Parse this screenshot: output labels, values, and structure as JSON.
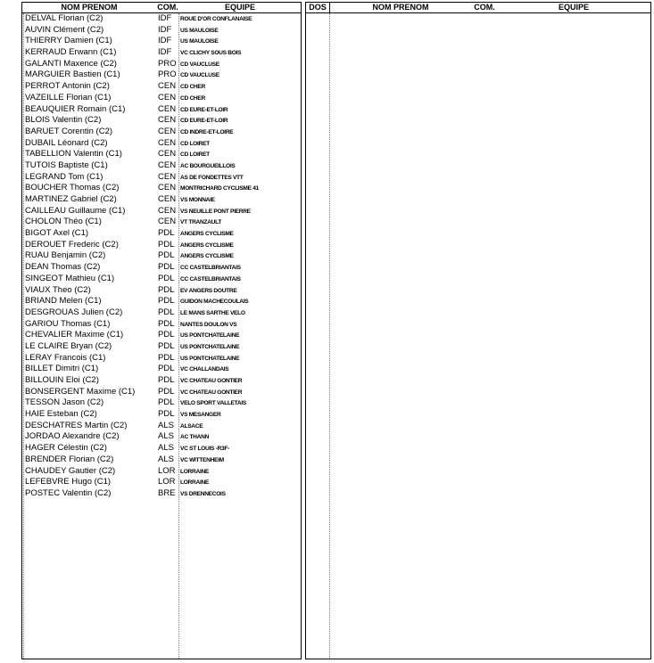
{
  "left_table": {
    "headers": {
      "name": "NOM PRENOM",
      "com": "COM.",
      "team": "EQUIPE"
    },
    "rows": [
      {
        "name": "DELVAL Florian (C2)",
        "com": "IDF",
        "team": "ROUE D'OR CONFLANAISE"
      },
      {
        "name": "AUVIN Clément (C2)",
        "com": "IDF",
        "team": "US MAULOISE"
      },
      {
        "name": "THIERRY Damien (C1)",
        "com": "IDF",
        "team": "US MAULOISE"
      },
      {
        "name": "KERRAUD Erwann (C1)",
        "com": "IDF",
        "team": "VC CLICHY SOUS BOIS"
      },
      {
        "name": "GALANTI Maxence (C2)",
        "com": "PRO",
        "team": "CD VAUCLUSE"
      },
      {
        "name": "MARGUIER Bastien (C1)",
        "com": "PRO",
        "team": "CD VAUCLUSE"
      },
      {
        "name": "PERROT Antonin (C2)",
        "com": "CEN",
        "team": "CD CHER"
      },
      {
        "name": "VAZEILLE Florian (C1)",
        "com": "CEN",
        "team": "CD CHER"
      },
      {
        "name": "BEAUQUIER Romain (C1)",
        "com": "CEN",
        "team": "CD EURE-ET-LOIR"
      },
      {
        "name": "BLOIS Valentin (C2)",
        "com": "CEN",
        "team": "CD EURE-ET-LOIR"
      },
      {
        "name": "BARUET Corentin (C2)",
        "com": "CEN",
        "team": "CD INDRE-ET-LOIRE"
      },
      {
        "name": "DUBAIL Léonard (C2)",
        "com": "CEN",
        "team": "CD LOIRET"
      },
      {
        "name": "TABELLION Valentin (C1)",
        "com": "CEN",
        "team": "CD LOIRET"
      },
      {
        "name": "TUTOIS Baptiste (C1)",
        "com": "CEN",
        "team": "AC BOURGUEILLOIS"
      },
      {
        "name": "LEGRAND Tom (C1)",
        "com": "CEN",
        "team": "AS DE FONDETTES VTT"
      },
      {
        "name": "BOUCHER Thomas (C2)",
        "com": "CEN",
        "team": "MONTRICHARD CYCLISME 41"
      },
      {
        "name": "MARTINEZ Gabriel (C2)",
        "com": "CEN",
        "team": "VS MONNAIE"
      },
      {
        "name": "CAILLEAU Guillaume (C1)",
        "com": "CEN",
        "team": "VS NEUILLE PONT PIERRE"
      },
      {
        "name": "CHOLON Théo (C1)",
        "com": "CEN",
        "team": "VT TRANZAULT"
      },
      {
        "name": "BIGOT Axel (C1)",
        "com": "PDL",
        "team": "ANGERS CYCLISME"
      },
      {
        "name": "DEROUET Frederic (C2)",
        "com": "PDL",
        "team": "ANGERS CYCLISME"
      },
      {
        "name": "RUAU Benjamin (C2)",
        "com": "PDL",
        "team": "ANGERS CYCLISME"
      },
      {
        "name": "DEAN Thomas (C2)",
        "com": "PDL",
        "team": "CC CASTELBRIANTAIS"
      },
      {
        "name": "SINGEOT Mathieu (C1)",
        "com": "PDL",
        "team": "CC CASTELBRIANTAIS"
      },
      {
        "name": "VIAUX Theo (C2)",
        "com": "PDL",
        "team": "EV ANGERS DOUTRE"
      },
      {
        "name": "BRIAND Melen (C1)",
        "com": "PDL",
        "team": "GUIDON MACHECOULAIS"
      },
      {
        "name": "DESGROUAS Julien (C2)",
        "com": "PDL",
        "team": "LE MANS SARTHE VELO"
      },
      {
        "name": "GARIOU Thomas (C1)",
        "com": "PDL",
        "team": "NANTES DOULON VS"
      },
      {
        "name": "CHEVALIER Maxime (C1)",
        "com": "PDL",
        "team": "US PONTCHATELAINE"
      },
      {
        "name": "LE CLAIRE Bryan (C2)",
        "com": "PDL",
        "team": "US PONTCHATELAINE"
      },
      {
        "name": "LERAY Francois (C1)",
        "com": "PDL",
        "team": "US PONTCHATELAINE"
      },
      {
        "name": "BILLET Dimitri (C1)",
        "com": "PDL",
        "team": "VC CHALLANDAIS"
      },
      {
        "name": "BILLOUIN Eloi (C2)",
        "com": "PDL",
        "team": "VC CHATEAU GONTIER"
      },
      {
        "name": "BONSERGENT Maxime (C1)",
        "com": "PDL",
        "team": "VC CHATEAU GONTIER"
      },
      {
        "name": "TESSON Jason (C2)",
        "com": "PDL",
        "team": "VELO SPORT VALLETAIS"
      },
      {
        "name": "HAIE Esteban (C2)",
        "com": "PDL",
        "team": "VS MESANGER"
      },
      {
        "name": "DESCHATRES Martin (C2)",
        "com": "ALS",
        "team": "ALSACE"
      },
      {
        "name": "JORDAO Alexandre (C2)",
        "com": "ALS",
        "team": "AC THANN"
      },
      {
        "name": "HAGER Célestin (C2)",
        "com": "ALS",
        "team": "VC ST LOUIS -R3F-"
      },
      {
        "name": "BRENDER Florian (C2)",
        "com": "ALS",
        "team": "VC WITTENHEIM"
      },
      {
        "name": "CHAUDEY Gautier (C2)",
        "com": "LOR",
        "team": "LORRAINE"
      },
      {
        "name": "LEFEBVRE Hugo (C1)",
        "com": "LOR",
        "team": "LORRAINE"
      },
      {
        "name": "POSTEC Valentin (C2)",
        "com": "BRE",
        "team": "VS DRENNECOIS"
      }
    ]
  },
  "right_table": {
    "headers": {
      "dos": "DOS",
      "name": "NOM PRENOM",
      "com": "COM.",
      "team": "EQUIPE"
    }
  }
}
